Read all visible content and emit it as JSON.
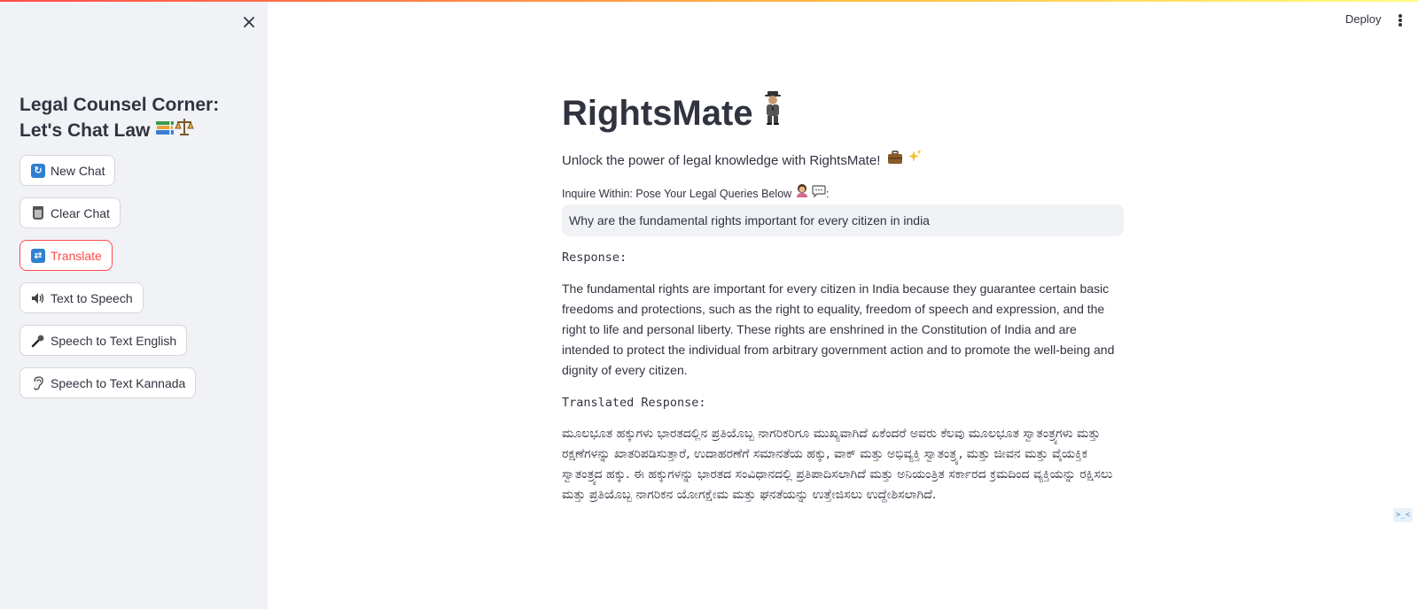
{
  "header": {
    "deploy_label": "Deploy",
    "menu_icon": "vertical-dots-icon"
  },
  "sidebar": {
    "close_icon": "close-icon",
    "title": "Legal Counsel Corner: Let's Chat Law",
    "title_icons": [
      "books-icon",
      "scales-icon"
    ],
    "buttons": [
      {
        "label": "New Chat",
        "icon": "refresh-icon"
      },
      {
        "label": "Clear Chat",
        "icon": "trash-icon"
      },
      {
        "label": "Translate",
        "icon": "repeat-icon",
        "active": true
      },
      {
        "label": "Text to Speech",
        "icon": "speaker-icon"
      },
      {
        "label": "Speech to Text English",
        "icon": "microphone-icon"
      },
      {
        "label": "Speech to Text Kannada",
        "icon": "ear-icon"
      }
    ]
  },
  "main": {
    "title": "RightsMate",
    "title_icon": "businessman-icon",
    "subtitle": "Unlock the power of legal knowledge with RightsMate!",
    "subtitle_icons": [
      "briefcase-icon",
      "sparkles-icon"
    ],
    "input_label": "Inquire Within: Pose Your Legal Queries Below",
    "input_label_icons": [
      "person-icon",
      "speech-bubble-icon"
    ],
    "input_label_suffix": ":",
    "query_value": "Why are the fundamental rights important for every citizen in india",
    "response_label": "Response:",
    "response_text": "The fundamental rights are important for every citizen in India because they guarantee certain basic freedoms and protections, such as the right to equality, freedom of speech and expression, and the right to life and personal liberty. These rights are enshrined in the Constitution of India and are intended to protect the individual from arbitrary government action and to promote the well-being and dignity of every citizen.",
    "translated_label": "Translated Response:",
    "translated_text": "ಮೂಲಭೂತ ಹಕ್ಕುಗಳು ಭಾರತದಲ್ಲಿನ ಪ್ರತಿಯೊಬ್ಬ ನಾಗರಿಕರಿಗೂ ಮುಖ್ಯವಾಗಿದೆ ಏಕೆಂದರೆ ಅವರು ಕೆಲವು ಮೂಲಭೂತ ಸ್ವಾತಂತ್ರ್ಯಗಳು ಮತ್ತು ರಕ್ಷಣೆಗಳನ್ನು ಖಾತರಿಪಡಿಸುತ್ತಾರೆ, ಉದಾಹರಣೆಗೆ ಸಮಾನತೆಯ ಹಕ್ಕು, ವಾಕ್ ಮತ್ತು ಅಭಿವ್ಯಕ್ತಿ ಸ್ವಾತಂತ್ರ್ಯ, ಮತ್ತು ಜೀವನ ಮತ್ತು ವೈಯಕ್ತಿಕ ಸ್ವಾತಂತ್ರ್ಯದ ಹಕ್ಕು. ಈ ಹಕ್ಕುಗಳನ್ನು ಭಾರತದ ಸಂವಿಧಾನದಲ್ಲಿ ಪ್ರತಿಪಾದಿಸಲಾಗಿದೆ ಮತ್ತು ಅನಿಯಂತ್ರಿತ ಸರ್ಕಾರದ ಕ್ರಮದಿಂದ ವ್ಯಕ್ತಿಯನ್ನು ರಕ್ಷಿಸಲು ಮತ್ತು ಪ್ರತಿಯೊಬ್ಬ ನಾಗರಿಕನ ಯೋಗಕ್ಷೇಮ ಮತ್ತು ಘನತೆಯನ್ನು ಉತ್ತೇಜಿಸಲು ಉದ್ದೇಶಿಸಲಾಗಿದೆ."
  },
  "colors": {
    "sidebar_bg": "#f0f2f6",
    "accent": "#ff4b4b",
    "text": "#31333f"
  }
}
